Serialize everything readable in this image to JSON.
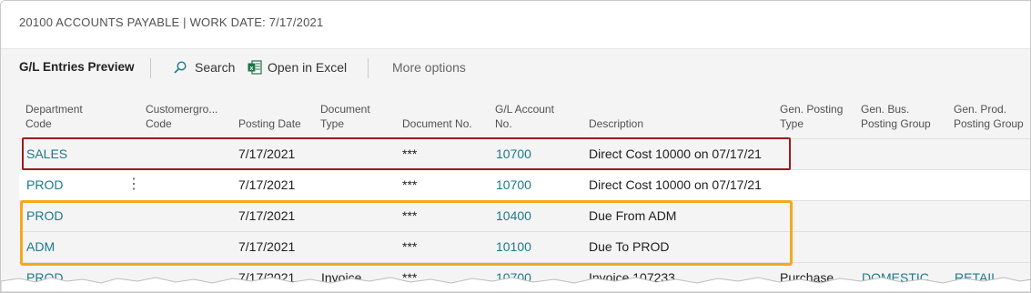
{
  "window": {
    "title": "20100 ACCOUNTS PAYABLE | WORK DATE: 7/17/2021"
  },
  "toolbar": {
    "page_name": "G/L Entries Preview",
    "search_label": "Search",
    "excel_label": "Open in Excel",
    "more_label": "More options"
  },
  "columns": {
    "department_code": [
      "Department",
      "Code"
    ],
    "customergroup_code": [
      "Customergro...",
      "Code"
    ],
    "posting_date": [
      "",
      "Posting Date"
    ],
    "document_type": [
      "Document",
      "Type"
    ],
    "document_no": [
      "",
      "Document No."
    ],
    "gl_account_no": [
      "G/L Account",
      "No."
    ],
    "description": [
      "",
      "Description"
    ],
    "gen_posting_type": [
      "Gen. Posting",
      "Type"
    ],
    "gen_bus_posting_group": [
      "Gen. Bus.",
      "Posting Group"
    ],
    "gen_prod_posting_group": [
      "Gen. Prod.",
      "Posting Group"
    ]
  },
  "rows": [
    {
      "dept": "SALES",
      "posting_date": "7/17/2021",
      "doc_type": "",
      "doc_no": "***",
      "gl_account": "10700",
      "description": "Direct Cost 10000 on 07/17/21",
      "gen_posting_type": "",
      "gen_bus": "",
      "gen_prod": ""
    },
    {
      "dept": "PROD",
      "posting_date": "7/17/2021",
      "doc_type": "",
      "doc_no": "***",
      "gl_account": "10700",
      "description": "Direct Cost 10000 on 07/17/21",
      "gen_posting_type": "",
      "gen_bus": "",
      "gen_prod": ""
    },
    {
      "dept": "PROD",
      "posting_date": "7/17/2021",
      "doc_type": "",
      "doc_no": "***",
      "gl_account": "10400",
      "description": "Due From ADM",
      "gen_posting_type": "",
      "gen_bus": "",
      "gen_prod": ""
    },
    {
      "dept": "ADM",
      "posting_date": "7/17/2021",
      "doc_type": "",
      "doc_no": "***",
      "gl_account": "10100",
      "description": "Due To PROD",
      "gen_posting_type": "",
      "gen_bus": "",
      "gen_prod": ""
    },
    {
      "dept": "PROD",
      "posting_date": "7/17/2021",
      "doc_type": "Invoice",
      "doc_no": "***",
      "gl_account": "10700",
      "description": "Invoice 107233",
      "gen_posting_type": "Purchase",
      "gen_bus": "DOMESTIC",
      "gen_prod": "RETAIL"
    }
  ],
  "colors": {
    "link": "#1a7a8a",
    "highlight_red": "#9b1c1c",
    "highlight_orange": "#f5a81c"
  }
}
